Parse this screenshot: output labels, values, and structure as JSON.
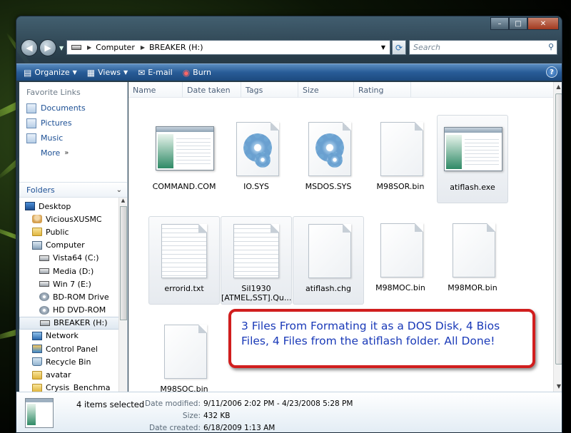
{
  "window": {
    "captions": {
      "minimize": "–",
      "maximize": "□",
      "close": "✕"
    }
  },
  "address": {
    "path": [
      "Computer",
      "BREAKER (H:)"
    ],
    "search_placeholder": "Search"
  },
  "toolbar": {
    "organize": "Organize",
    "views": "Views",
    "email": "E-mail",
    "burn": "Burn",
    "help": "?"
  },
  "nav": {
    "favorites_heading": "Favorite Links",
    "favorites": [
      "Documents",
      "Pictures",
      "Music"
    ],
    "more": "More",
    "folders_heading": "Folders",
    "tree": [
      {
        "label": "Desktop",
        "icon": "desktop-icon",
        "indent": 0
      },
      {
        "label": "ViciousXUSMC",
        "icon": "user-folder-icon",
        "indent": 1
      },
      {
        "label": "Public",
        "icon": "folder-icon",
        "indent": 1
      },
      {
        "label": "Computer",
        "icon": "computer-icon",
        "indent": 1
      },
      {
        "label": "Vista64 (C:)",
        "icon": "drive-icon",
        "indent": 2
      },
      {
        "label": "Media (D:)",
        "icon": "drive-icon",
        "indent": 2
      },
      {
        "label": "Win 7 (E:)",
        "icon": "drive-icon",
        "indent": 2
      },
      {
        "label": "BD-ROM Drive",
        "icon": "optical-drive-icon",
        "indent": 2
      },
      {
        "label": "HD DVD-ROM",
        "icon": "optical-drive-icon",
        "indent": 2
      },
      {
        "label": "BREAKER (H:)",
        "icon": "usb-drive-icon",
        "indent": 2,
        "selected": true
      },
      {
        "label": "Network",
        "icon": "network-icon",
        "indent": 1
      },
      {
        "label": "Control Panel",
        "icon": "control-panel-icon",
        "indent": 1
      },
      {
        "label": "Recycle Bin",
        "icon": "recycle-bin-icon",
        "indent": 1
      },
      {
        "label": "avatar",
        "icon": "folder-icon",
        "indent": 1
      },
      {
        "label": "Crysis_Benchma",
        "icon": "folder-icon",
        "indent": 1
      }
    ]
  },
  "columns": [
    "Name",
    "Date taken",
    "Tags",
    "Size",
    "Rating"
  ],
  "files": [
    {
      "name": "COMMAND.COM",
      "type": "window",
      "selected": false
    },
    {
      "name": "IO.SYS",
      "type": "gear",
      "selected": false
    },
    {
      "name": "MSDOS.SYS",
      "type": "gear",
      "selected": false
    },
    {
      "name": "M98SOR.bin",
      "type": "blank",
      "selected": false
    },
    {
      "name": "atiflash.exe",
      "type": "window",
      "selected": true
    },
    {
      "name": "errorid.txt",
      "type": "text",
      "selected": true
    },
    {
      "name": "SiI1930 [ATMEL,SST].Qu...",
      "type": "text",
      "selected": true
    },
    {
      "name": "atiflash.chg",
      "type": "blank",
      "selected": true
    },
    {
      "name": "M98MOC.bin",
      "type": "blank",
      "selected": false
    },
    {
      "name": "M98MOR.bin",
      "type": "blank",
      "selected": false
    },
    {
      "name": "M98SOC.bin",
      "type": "blank",
      "selected": false
    }
  ],
  "callout": "3 Files From Formating it as a DOS Disk, 4 Bios Files, 4 Files from the atiflash folder.  All Done!",
  "details": {
    "selected": "4 items selected",
    "rows": [
      {
        "key": "Date modified:",
        "value": "9/11/2006 2:02 PM - 4/23/2008 5:28 PM"
      },
      {
        "key": "Size:",
        "value": "432 KB"
      },
      {
        "key": "Date created:",
        "value": "6/18/2009 1:13 AM"
      }
    ]
  }
}
